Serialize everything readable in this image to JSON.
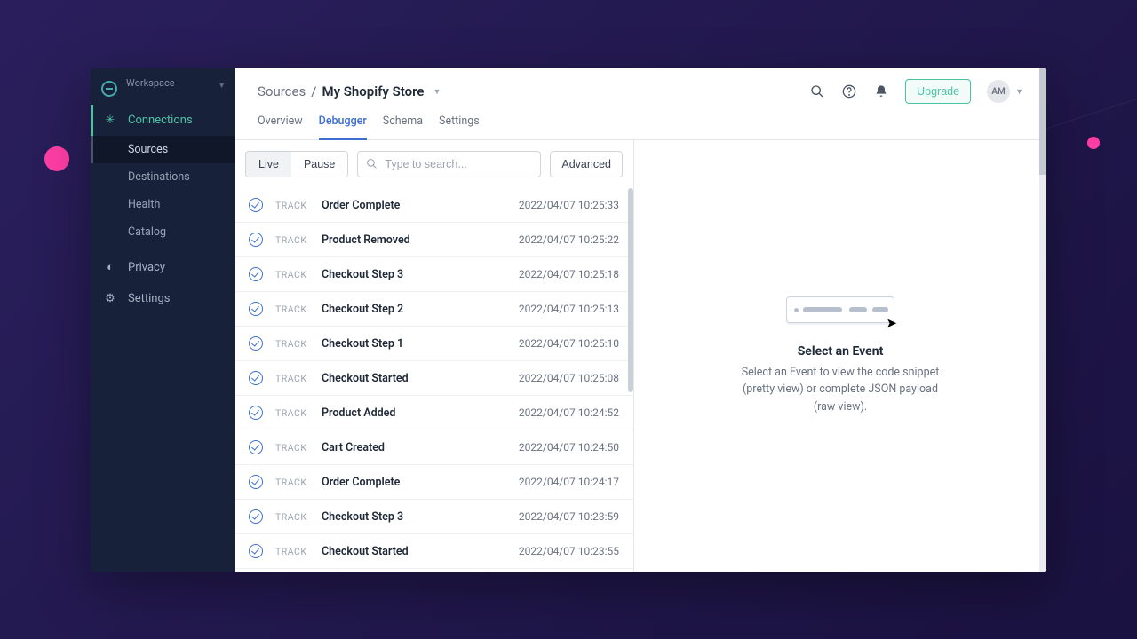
{
  "sidebar": {
    "workspace_label": "Workspace",
    "items": {
      "connections": "Connections",
      "privacy": "Privacy",
      "settings": "Settings"
    },
    "sub": {
      "sources": "Sources",
      "destinations": "Destinations",
      "health": "Health",
      "catalog": "Catalog"
    }
  },
  "breadcrumb": {
    "root": "Sources",
    "sep": "/",
    "current": "My Shopify Store"
  },
  "header": {
    "upgrade": "Upgrade",
    "avatar": "AM"
  },
  "tabs": {
    "overview": "Overview",
    "debugger": "Debugger",
    "schema": "Schema",
    "settings": "Settings"
  },
  "toolbar": {
    "live": "Live",
    "pause": "Pause",
    "search_placeholder": "Type to search...",
    "advanced": "Advanced"
  },
  "events": [
    {
      "type": "TRACK",
      "name": "Order Complete",
      "ts": "2022/04/07 10:25:33"
    },
    {
      "type": "TRACK",
      "name": "Product Removed",
      "ts": "2022/04/07 10:25:22"
    },
    {
      "type": "TRACK",
      "name": "Checkout Step 3",
      "ts": "2022/04/07 10:25:18"
    },
    {
      "type": "TRACK",
      "name": "Checkout Step 2",
      "ts": "2022/04/07 10:25:13"
    },
    {
      "type": "TRACK",
      "name": "Checkout Step 1",
      "ts": "2022/04/07 10:25:10"
    },
    {
      "type": "TRACK",
      "name": "Checkout Started",
      "ts": "2022/04/07 10:25:08"
    },
    {
      "type": "TRACK",
      "name": "Product Added",
      "ts": "2022/04/07 10:24:52"
    },
    {
      "type": "TRACK",
      "name": "Cart Created",
      "ts": "2022/04/07 10:24:50"
    },
    {
      "type": "TRACK",
      "name": "Order Complete",
      "ts": "2022/04/07 10:24:17"
    },
    {
      "type": "TRACK",
      "name": "Checkout Step 3",
      "ts": "2022/04/07 10:23:59"
    },
    {
      "type": "TRACK",
      "name": "Checkout Started",
      "ts": "2022/04/07 10:23:55"
    }
  ],
  "detail": {
    "title": "Select an Event",
    "desc": "Select an Event to view the code snippet (pretty view) or complete JSON payload (raw view)."
  }
}
